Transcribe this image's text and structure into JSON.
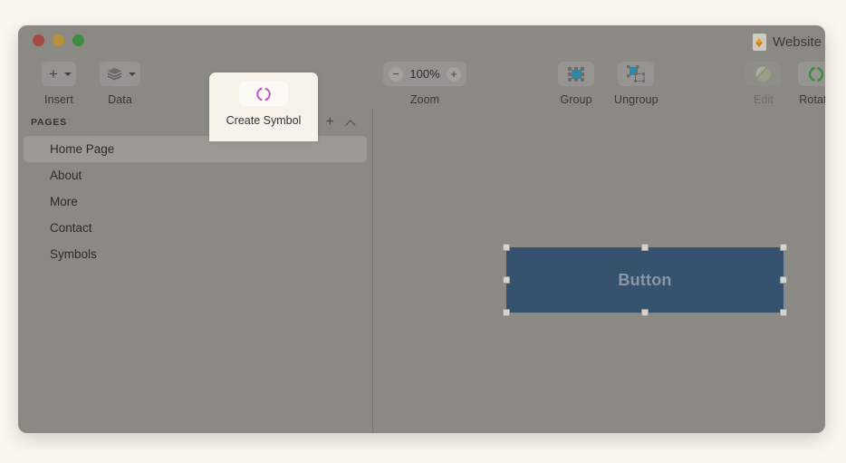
{
  "window": {
    "title": "Website",
    "doc_icon": "sketch-document-icon",
    "traffic_lights": [
      "close",
      "minimize",
      "maximize"
    ]
  },
  "toolbar": {
    "groups": [
      {
        "id": "insert",
        "label": "Insert",
        "icon": "plus-icon",
        "has_chevron": true,
        "enabled": true
      },
      {
        "id": "data",
        "label": "Data",
        "icon": "layers-stack-icon",
        "has_chevron": true,
        "enabled": true
      },
      {
        "id": "zoom",
        "label": "Zoom",
        "icon": "zoom-stepper",
        "has_chevron": false,
        "enabled": true
      },
      {
        "id": "group",
        "label": "Group",
        "icon": "group-icon",
        "has_chevron": false,
        "enabled": true
      },
      {
        "id": "ungroup",
        "label": "Ungroup",
        "icon": "ungroup-icon",
        "has_chevron": false,
        "enabled": true
      },
      {
        "id": "edit",
        "label": "Edit",
        "icon": "edit-shape-icon",
        "has_chevron": false,
        "enabled": false
      },
      {
        "id": "rotate",
        "label": "Rotate",
        "icon": "rotate-copies-icon",
        "has_chevron": false,
        "enabled": true
      }
    ],
    "zoom": {
      "value": "100%",
      "minus_label": "−",
      "plus_label": "+"
    },
    "insert_plus": "+",
    "create_symbol": {
      "label": "Create Symbol",
      "icon": "create-symbol-icon",
      "accent": "#C04FD0"
    }
  },
  "sidebar": {
    "section_title": "PAGES",
    "add_label": "+",
    "collapse_icon": "chevron-up-icon",
    "items": [
      {
        "label": "Home Page",
        "selected": true
      },
      {
        "label": "About",
        "selected": false
      },
      {
        "label": "More",
        "selected": false
      },
      {
        "label": "Contact",
        "selected": false
      },
      {
        "label": "Symbols",
        "selected": false
      }
    ]
  },
  "canvas": {
    "selected_shape": {
      "name": "Button",
      "text": "Button",
      "fill": "#35536F",
      "text_color": "#8A96A1",
      "selected": true,
      "handle_count": 8
    },
    "background": "#8B8983"
  },
  "colors": {
    "page_background": "#FBF7EE",
    "window_chrome": "#8B8983",
    "popover_background": "#F7F3EA",
    "shape_fill": "#35536F",
    "group_icon": "#2C87A8",
    "rotate_icon": "#3E8E3F",
    "symbol_icon": "#C04FD0"
  }
}
